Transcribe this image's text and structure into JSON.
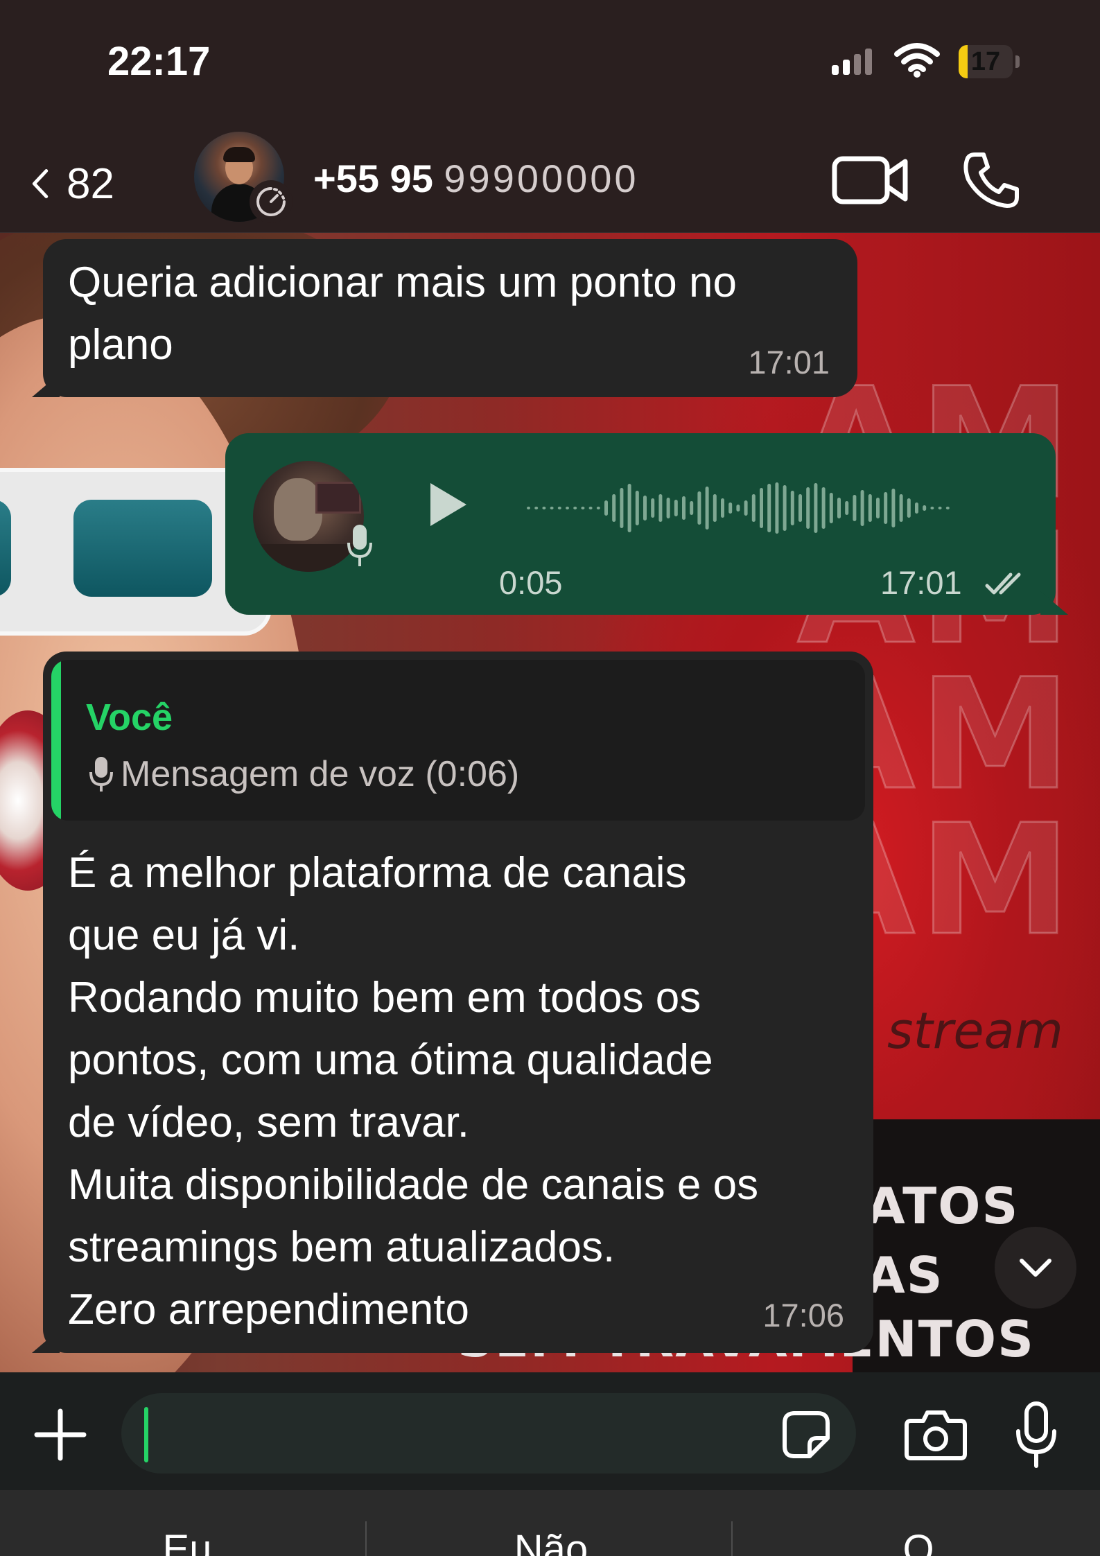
{
  "status_bar": {
    "time": "22:17",
    "battery": "17",
    "battery_level": 0.17
  },
  "header": {
    "back_count": "82",
    "contact_number": "+55 95",
    "contact_number_masked": "99900000",
    "icons": {
      "back": "chevron-left-icon",
      "timer": "disappearing-timer-icon",
      "video": "video-call-icon",
      "call": "phone-icon"
    }
  },
  "wallpaper": {
    "letters": [
      "AM",
      "AM",
      "AM",
      "AM"
    ],
    "stream_text": "stream",
    "promo_lines": [
      "ATOS",
      "AS"
    ],
    "promo_bottom": "SEM TRAVAMENTOS"
  },
  "messages": [
    {
      "type": "text",
      "direction": "incoming",
      "text": "Queria adicionar mais um ponto no plano",
      "time": "17:01"
    },
    {
      "type": "voice",
      "direction": "outgoing",
      "duration": "0:05",
      "time": "17:01",
      "status": "read",
      "progress": 0
    },
    {
      "type": "text",
      "direction": "incoming",
      "reply": {
        "author": "Você",
        "text": "Mensagem de voz (0:06)"
      },
      "lines": [
        "É a melhor plataforma de canais",
        "que eu já vi.",
        "Rodando muito bem em todos os",
        "pontos, com uma ótima qualidade",
        "de vídeo, sem travar.",
        "Muita disponibilidade de canais e os",
        "streamings bem atualizados.",
        "Zero arrependimento"
      ],
      "time": "17:06"
    }
  ],
  "input": {
    "placeholder": "",
    "icons": [
      "plus-icon",
      "sticker-icon",
      "camera-icon",
      "microphone-icon"
    ]
  },
  "keyboard_suggestions": [
    "Eu",
    "Não",
    "O"
  ],
  "colors": {
    "accent": "#25d366",
    "outgoing_bubble": "#144d37",
    "incoming_bubble": "#242424"
  }
}
